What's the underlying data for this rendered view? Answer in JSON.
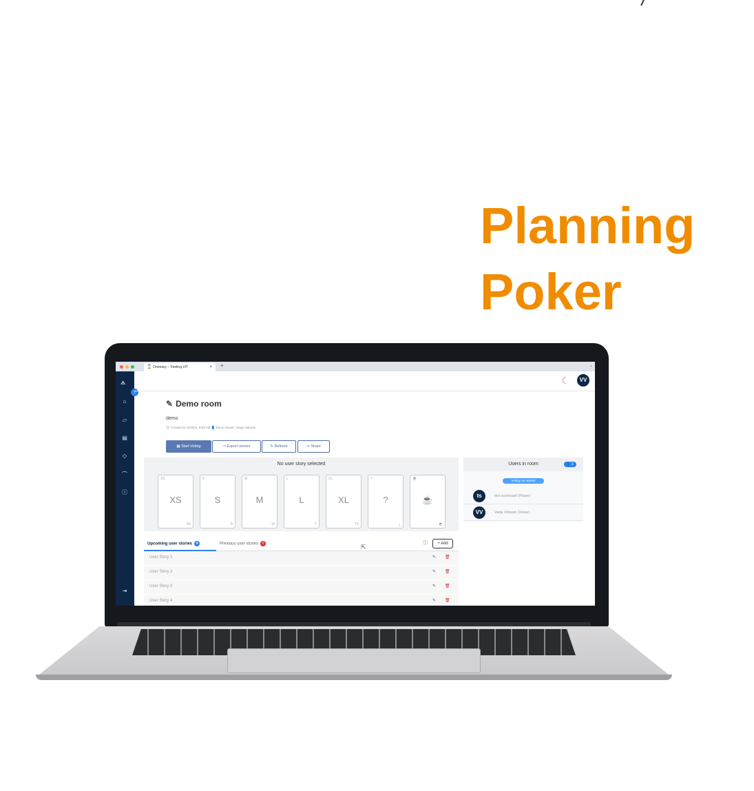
{
  "headline": {
    "line1": "Planning",
    "line2": "Poker"
  },
  "browser": {
    "tab_icon": "⌛",
    "tab_title": "Oneeasy – Feeling VIT",
    "tab_close": "×",
    "new_tab": "+"
  },
  "app": {
    "user_initials": "VV",
    "room": {
      "title": "Demo room",
      "description": "demo",
      "meta": "🕓 Created at: 8/23/24, 9:09 AM   👤 Room Owner: Vanja Vidmark"
    },
    "actions": {
      "start_voting": "Start Voting",
      "export_stories": "Export stories",
      "refresh": "Refresh",
      "share": "Share"
    },
    "voting": {
      "header": "No user story selected",
      "cards": [
        {
          "corner": "XS",
          "value": "XS",
          "corner_br": "SX"
        },
        {
          "corner": "S",
          "value": "S",
          "corner_br": "S"
        },
        {
          "corner": "M",
          "value": "M",
          "corner_br": "W"
        },
        {
          "corner": "L",
          "value": "L",
          "corner_br": "T"
        },
        {
          "corner": "XL",
          "value": "XL",
          "corner_br": "TX"
        },
        {
          "corner": "?",
          "value": "?",
          "corner_br": "¿"
        },
        {
          "corner": "☕",
          "value": "☕",
          "corner_br": "☕"
        }
      ]
    },
    "stories": {
      "tab_upcoming": "Upcoming user stories",
      "upcoming_count": "4",
      "tab_previous": "Previous user stories",
      "previous_count": "0",
      "add_label": "+ Add",
      "items": [
        "User Story 1",
        "User Story 2",
        "User Story 3",
        "User Story 4"
      ]
    },
    "users": {
      "header": "Users in room",
      "count": "👥2",
      "status": "Voting not started",
      "list": [
        {
          "initials": "ts",
          "name": "test scanlauset (Player)"
        },
        {
          "initials": "VV",
          "name": "Vanja Vidmark (Owner)"
        }
      ]
    }
  },
  "colors": {
    "accent": "#f08c00",
    "sidebar": "#0f2747",
    "primary_button": "#5b7ab3",
    "badge_blue": "#2f80ed",
    "badge_red": "#e03131"
  }
}
